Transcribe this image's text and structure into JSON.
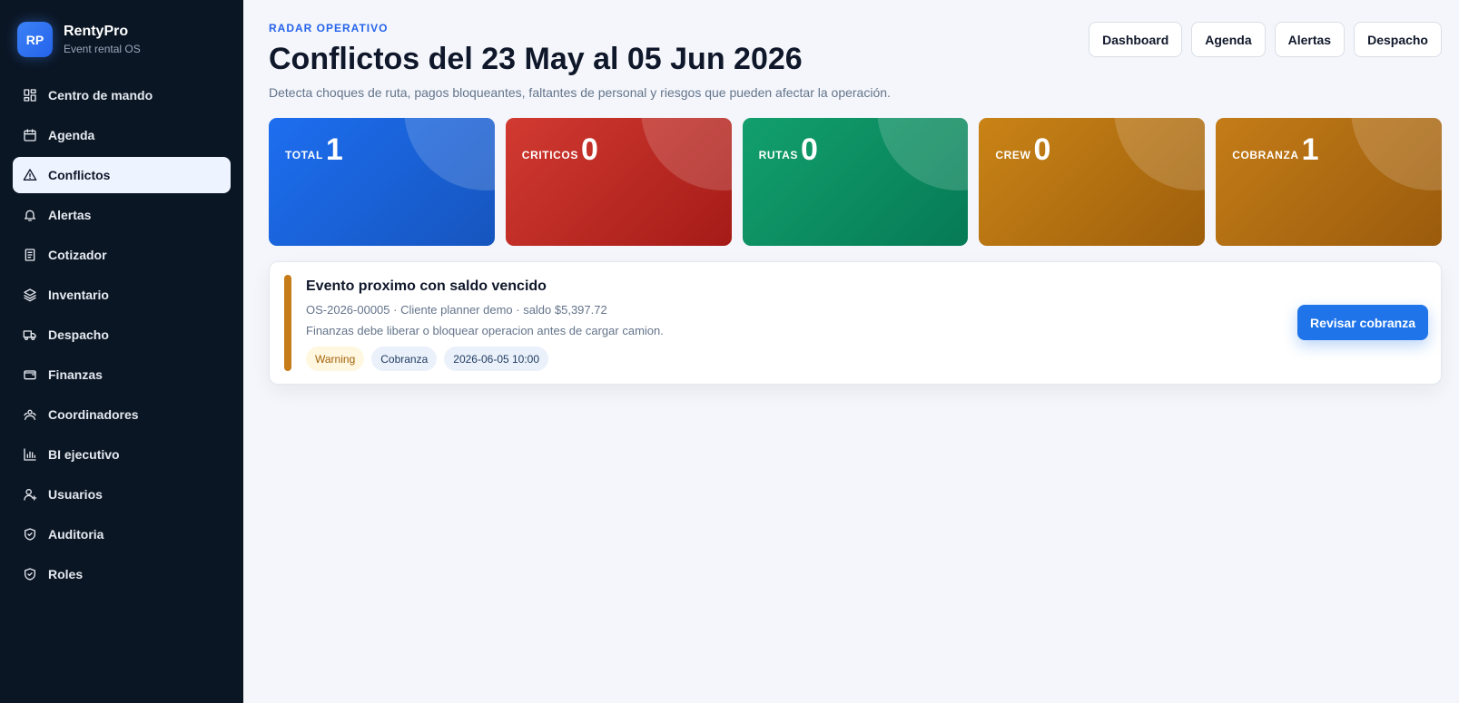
{
  "brand": {
    "initials": "RP",
    "name": "RentyPro",
    "subtitle": "Event rental OS"
  },
  "sidebar": {
    "items": [
      {
        "label": "Centro de mando",
        "icon": "dashboard-icon"
      },
      {
        "label": "Agenda",
        "icon": "calendar-icon"
      },
      {
        "label": "Conflictos",
        "icon": "warning-icon",
        "active": true
      },
      {
        "label": "Alertas",
        "icon": "bell-icon"
      },
      {
        "label": "Cotizador",
        "icon": "document-icon"
      },
      {
        "label": "Inventario",
        "icon": "layers-icon"
      },
      {
        "label": "Despacho",
        "icon": "truck-icon"
      },
      {
        "label": "Finanzas",
        "icon": "wallet-icon"
      },
      {
        "label": "Coordinadores",
        "icon": "users-icon"
      },
      {
        "label": "BI ejecutivo",
        "icon": "bar-chart-icon"
      },
      {
        "label": "Usuarios",
        "icon": "user-plus-icon"
      },
      {
        "label": "Auditoria",
        "icon": "shield-check-icon"
      },
      {
        "label": "Roles",
        "icon": "shield-check-icon"
      }
    ]
  },
  "header": {
    "eyebrow": "RADAR OPERATIVO",
    "title": "Conflictos del 23 May al 05 Jun 2026",
    "description": "Detecta choques de ruta, pagos bloqueantes, faltantes de personal y riesgos que pueden afectar la operación.",
    "actions": [
      "Dashboard",
      "Agenda",
      "Alertas",
      "Despacho"
    ]
  },
  "stats": [
    {
      "label": "TOTAL",
      "value": "1"
    },
    {
      "label": "CRITICOS",
      "value": "0"
    },
    {
      "label": "RUTAS",
      "value": "0"
    },
    {
      "label": "CREW",
      "value": "0"
    },
    {
      "label": "COBRANZA",
      "value": "1"
    }
  ],
  "conflict": {
    "title": "Evento proximo con saldo vencido",
    "meta": "OS-2026-00005 · Cliente planner demo · saldo $5,397.72",
    "note": "Finanzas debe liberar o bloquear operacion antes de cargar camion.",
    "tags": {
      "severity": "Warning",
      "category": "Cobranza",
      "date": "2026-06-05 10:00"
    },
    "action_label": "Revisar cobranza"
  },
  "colors": {
    "sidebar_bg": "#0b1624",
    "accent": "#1f74ea",
    "total": "#1d6ef0",
    "criticos": "#d13a31",
    "rutas": "#12a06d",
    "crew": "#c98316",
    "cobranza": "#c47c18",
    "warning_bar": "#c67c18"
  }
}
